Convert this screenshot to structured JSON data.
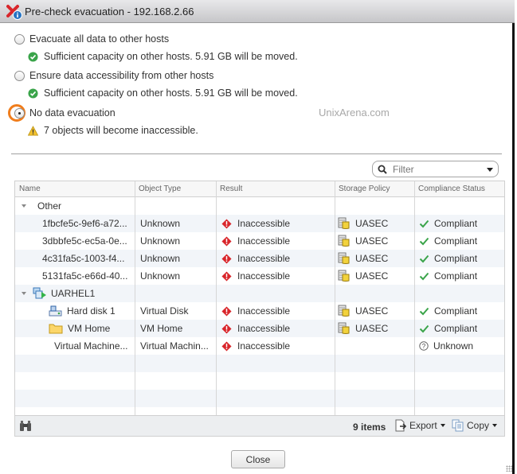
{
  "window": {
    "title": "Pre-check evacuation - 192.168.2.66"
  },
  "options": [
    {
      "label": "Evacuate all data to other hosts",
      "selected": false,
      "message": {
        "icon": "check-circle-icon",
        "text": "Sufficient capacity on other hosts. 5.91  GB will be moved."
      }
    },
    {
      "label": "Ensure data accessibility from other hosts",
      "selected": false,
      "message": {
        "icon": "check-circle-icon",
        "text": "Sufficient capacity on other hosts. 5.91  GB will be moved."
      }
    },
    {
      "label": "No data evacuation",
      "selected": true,
      "message": {
        "icon": "warning-icon",
        "text": "7 objects will become inaccessible."
      }
    }
  ],
  "watermark": "UnixArena.com",
  "filter": {
    "placeholder": "Filter"
  },
  "grid": {
    "columns": [
      "Name",
      "Object Type",
      "Result",
      "Storage Policy",
      "Compliance Status"
    ],
    "rows": [
      {
        "kind": "group",
        "name": "Other",
        "icon": ""
      },
      {
        "kind": "item",
        "name": "1fbcfe5c-9ef6-a72...",
        "type": "Unknown",
        "result": "Inaccessible",
        "policy": "UASEC",
        "compliance": "Compliant",
        "compliance_icon": "check"
      },
      {
        "kind": "item",
        "name": "3dbbfe5c-ec5a-0e...",
        "type": "Unknown",
        "result": "Inaccessible",
        "policy": "UASEC",
        "compliance": "Compliant",
        "compliance_icon": "check"
      },
      {
        "kind": "item",
        "name": "4c31fa5c-1003-f4...",
        "type": "Unknown",
        "result": "Inaccessible",
        "policy": "UASEC",
        "compliance": "Compliant",
        "compliance_icon": "check"
      },
      {
        "kind": "item",
        "name": "5131fa5c-e66d-40...",
        "type": "Unknown",
        "result": "Inaccessible",
        "policy": "UASEC",
        "compliance": "Compliant",
        "compliance_icon": "check"
      },
      {
        "kind": "group",
        "name": "UARHEL1",
        "icon": "vm"
      },
      {
        "kind": "child",
        "name": "Hard disk 1",
        "icon": "disk",
        "type": "Virtual Disk",
        "result": "Inaccessible",
        "policy": "UASEC",
        "compliance": "Compliant",
        "compliance_icon": "check"
      },
      {
        "kind": "child",
        "name": "VM Home",
        "icon": "folder",
        "type": "VM Home",
        "result": "Inaccessible",
        "policy": "UASEC",
        "compliance": "Compliant",
        "compliance_icon": "check"
      },
      {
        "kind": "child",
        "name": "Virtual Machine...",
        "icon": "",
        "type": "Virtual Machin...",
        "result": "Inaccessible",
        "policy": "",
        "compliance": "Unknown",
        "compliance_icon": "question"
      }
    ],
    "footer": {
      "count": "9 items",
      "export_label": "Export",
      "copy_label": "Copy"
    }
  },
  "buttons": {
    "close_label": "Close"
  },
  "colors": {
    "accent_highlight": "#f07d1c",
    "success": "#3aa44a",
    "error": "#d9262b",
    "warning": "#f2c12e"
  }
}
